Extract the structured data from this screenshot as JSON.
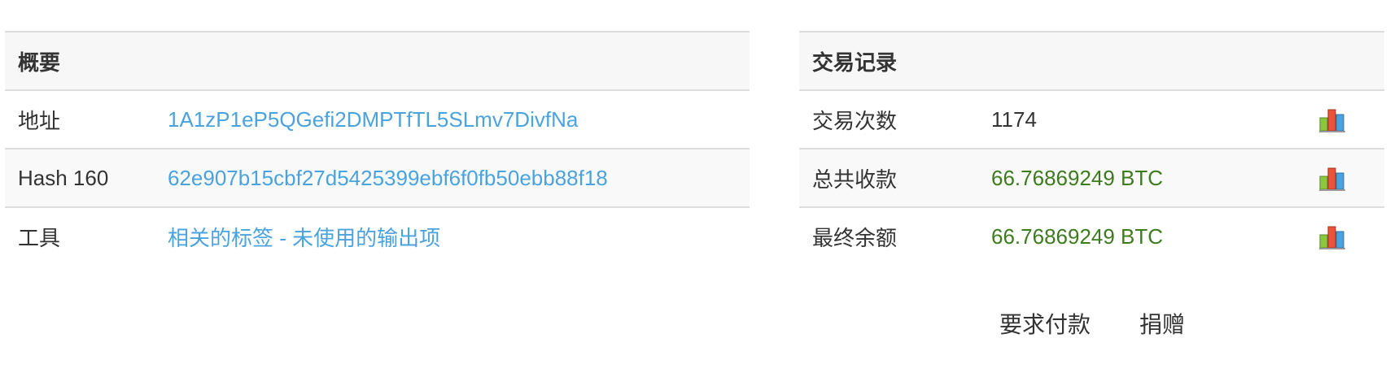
{
  "summary": {
    "title": "概要",
    "address_label": "地址",
    "address_value": "1A1zP1eP5QGefi2DMPTfTL5SLmv7DivfNa",
    "hash_label": "Hash 160",
    "hash_value": "62e907b15cbf27d5425399ebf6f0fb50ebb88f18",
    "tools_label": "工具",
    "tools_link1": "相关的标签",
    "tools_separator": " - ",
    "tools_link2": "未使用的输出项"
  },
  "transactions": {
    "title": "交易记录",
    "rows": [
      {
        "label": "交易次数",
        "value": "1174",
        "icon": "bar-chart-icon"
      },
      {
        "label": "总共收款",
        "value": "66.76869249 BTC",
        "icon": "bar-chart-icon"
      },
      {
        "label": "最终余额",
        "value": "66.76869249 BTC",
        "icon": "bar-chart-icon"
      }
    ]
  },
  "actions": {
    "request_payment": "要求付款",
    "donate": "捐赠"
  },
  "colors": {
    "link": "#4aa3df",
    "btc_value": "#3d7c1d",
    "header_bg": "#f7f7f7",
    "border": "#dddddd"
  }
}
